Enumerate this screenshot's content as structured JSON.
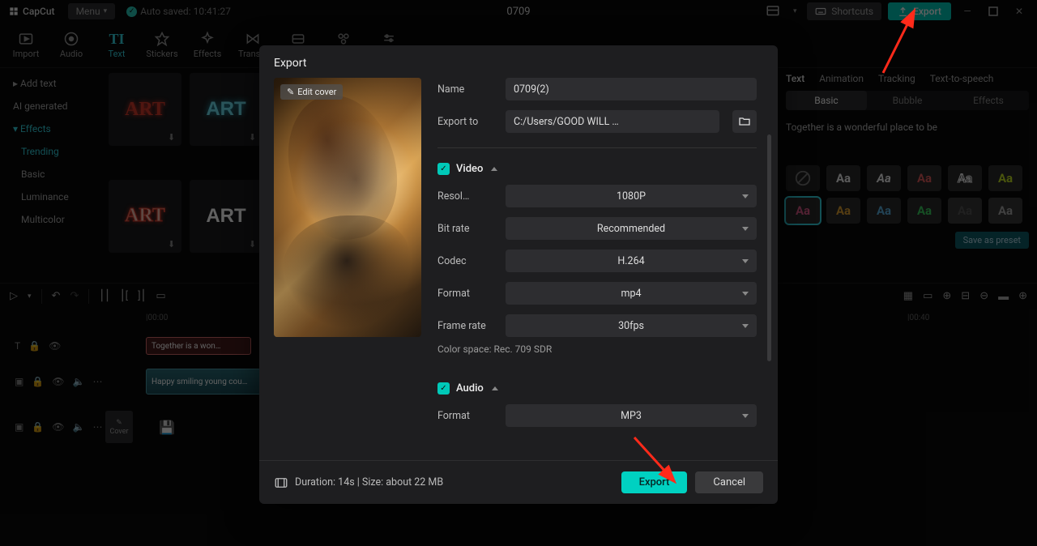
{
  "topbar": {
    "app": "CapCut",
    "menu": "Menu",
    "autosave": "Auto saved: 10:41:27",
    "title": "0709",
    "shortcuts": "Shortcuts",
    "export": "Export"
  },
  "toptools": [
    {
      "id": "import",
      "label": "Import"
    },
    {
      "id": "audio",
      "label": "Audio"
    },
    {
      "id": "text",
      "label": "Text",
      "active": true
    },
    {
      "id": "stickers",
      "label": "Stickers"
    },
    {
      "id": "effects",
      "label": "Effects"
    },
    {
      "id": "transitions",
      "label": "Trans..."
    }
  ],
  "leftnav": [
    {
      "label": "Add text",
      "bullet": true
    },
    {
      "label": "AI generated"
    },
    {
      "label": "Effects",
      "bullet": true,
      "active": true
    },
    {
      "label": "Trending",
      "active": true,
      "indent": true
    },
    {
      "label": "Basic",
      "indent": true
    },
    {
      "label": "Luminance",
      "indent": true
    },
    {
      "label": "Multicolor",
      "indent": true
    }
  ],
  "thumbs": [
    "ART",
    "ART",
    "ART",
    "ART"
  ],
  "rightpanel": {
    "tabs": [
      "Text",
      "Animation",
      "Tracking",
      "Text-to-speech"
    ],
    "subtabs": [
      "Basic",
      "Bubble",
      "Effects"
    ],
    "text": "Together is a wonderful place to be",
    "save_preset": "Save as preset"
  },
  "timeline": {
    "time_ticks": [
      "00:00",
      "00:40"
    ],
    "clip_text": "Together is a won…",
    "clip_video": "Happy smiling young cou…",
    "cover": "Cover"
  },
  "dialog": {
    "title": "Export",
    "edit_cover": "Edit cover",
    "name_label": "Name",
    "name_value": "0709(2)",
    "exportto_label": "Export to",
    "exportto_value": "C:/Users/GOOD WILL …",
    "video_label": "Video",
    "resol_label": "Resol…",
    "resol_value": "1080P",
    "bitrate_label": "Bit rate",
    "bitrate_value": "Recommended",
    "codec_label": "Codec",
    "codec_value": "H.264",
    "format_label": "Format",
    "format_value": "mp4",
    "frame_label": "Frame rate",
    "frame_value": "30fps",
    "colorspace": "Color space: Rec. 709 SDR",
    "audio_label": "Audio",
    "audio_format_label": "Format",
    "audio_format_value": "MP3",
    "foot_info": "Duration: 14s | Size: about 22 MB",
    "export_btn": "Export",
    "cancel_btn": "Cancel"
  }
}
